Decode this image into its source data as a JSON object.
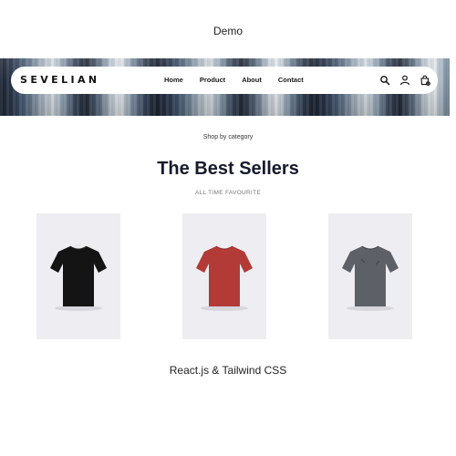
{
  "caption_top": "Demo",
  "navbar": {
    "brand": "SEVELIAN",
    "links": [
      "Home",
      "Product",
      "About",
      "Contact"
    ],
    "icons": [
      "search-icon",
      "user-icon",
      "cart-icon"
    ],
    "cart_count": "0"
  },
  "section": {
    "eyebrow": "Shop by category",
    "title": "The Best Sellers",
    "subtitle": "ALL TIME FAVOURITE"
  },
  "products": [
    {
      "color": "#141414"
    },
    {
      "color": "#b23a37"
    },
    {
      "color": "#5d6066"
    }
  ],
  "caption_bottom": "React.js & Tailwind CSS"
}
